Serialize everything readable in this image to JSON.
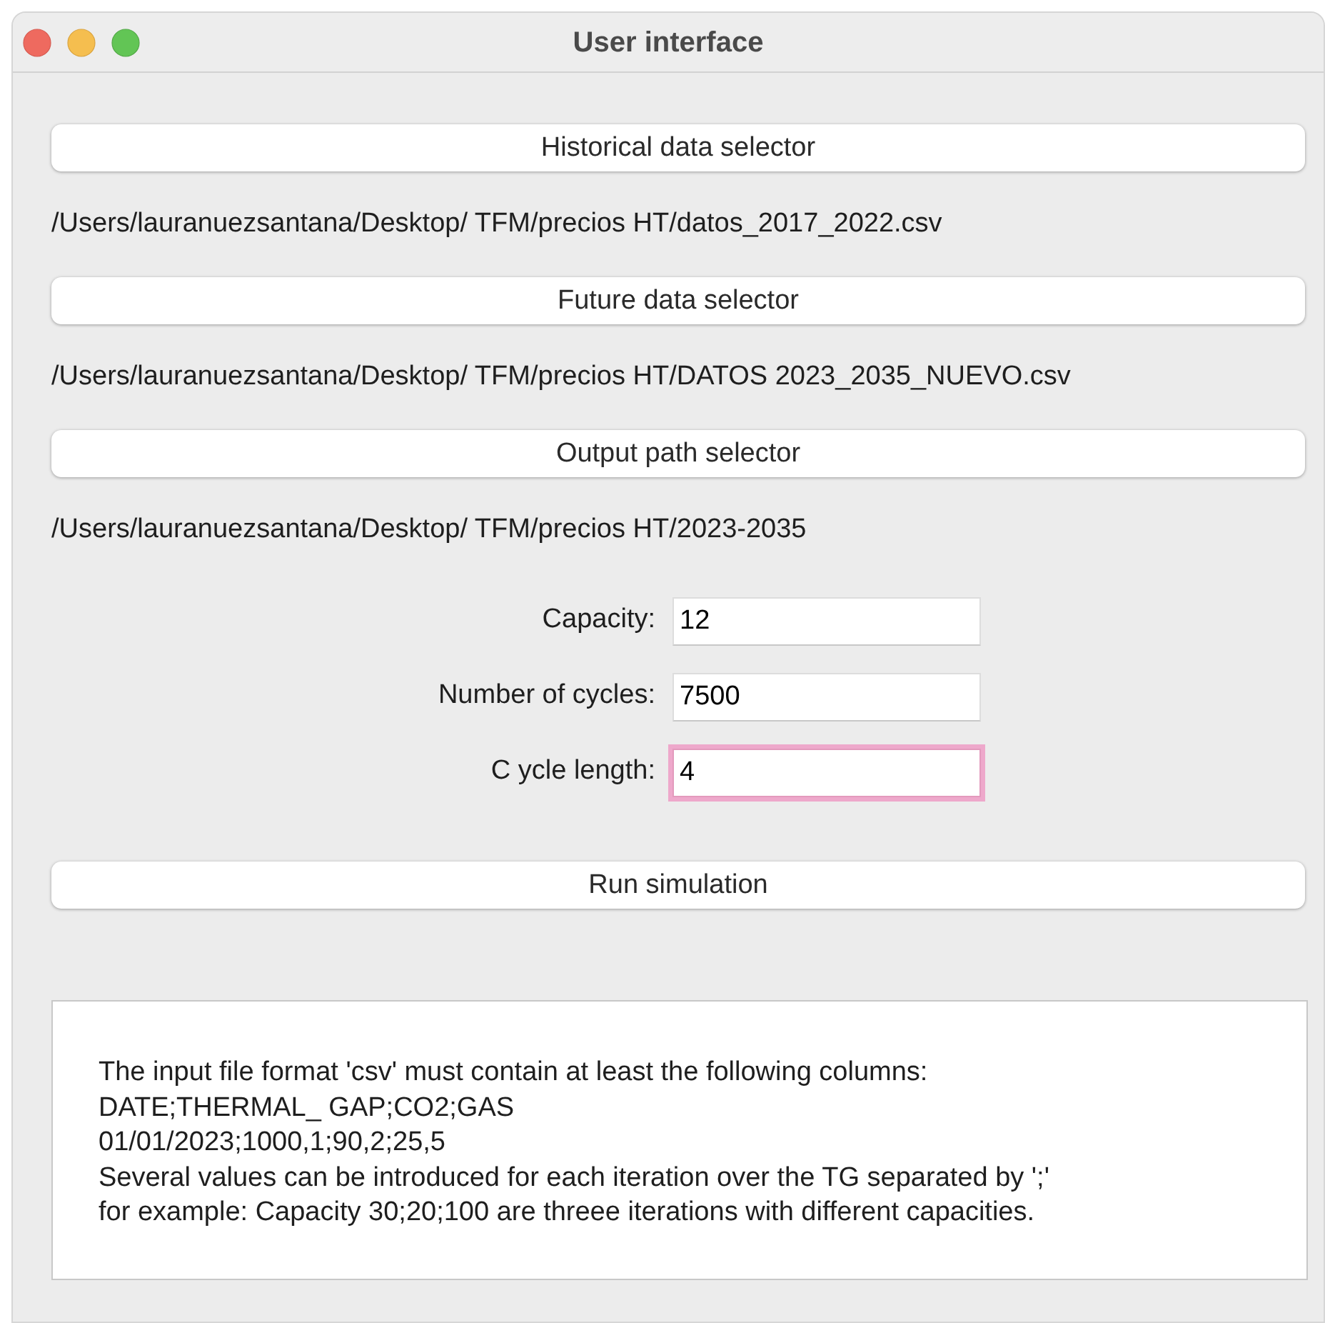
{
  "window": {
    "title": "User interface"
  },
  "selectors": [
    {
      "button": "Historical data selector",
      "path": "/Users/lauranuezsantana/Desktop/ TFM/precios HT/datos_2017_2022.csv"
    },
    {
      "button": "Future data selector",
      "path": "/Users/lauranuezsantana/Desktop/ TFM/precios HT/DATOS 2023_2035_NUEVO.csv"
    },
    {
      "button": "Output path selector",
      "path": "/Users/lauranuezsantana/Desktop/ TFM/precios HT/2023-2035"
    }
  ],
  "fields": [
    {
      "label": "Capacity:",
      "value": "12",
      "focused": false
    },
    {
      "label": "Number of cycles:",
      "value": "7500",
      "focused": false
    },
    {
      "label": "C ycle length:",
      "value": "4",
      "focused": true
    }
  ],
  "run_button": "Run simulation",
  "info_lines": [
    "The input file format 'csv' must contain at least the following columns:",
    "DATE;THERMAL_ GAP;CO2;GAS",
    "01/01/2023;1000,1;90,2;25,5",
    "Several values can be introduced for each iteration over the TG separated by ';'",
    "for example: Capacity 30;20;100 are threee iterations with different capacities."
  ]
}
